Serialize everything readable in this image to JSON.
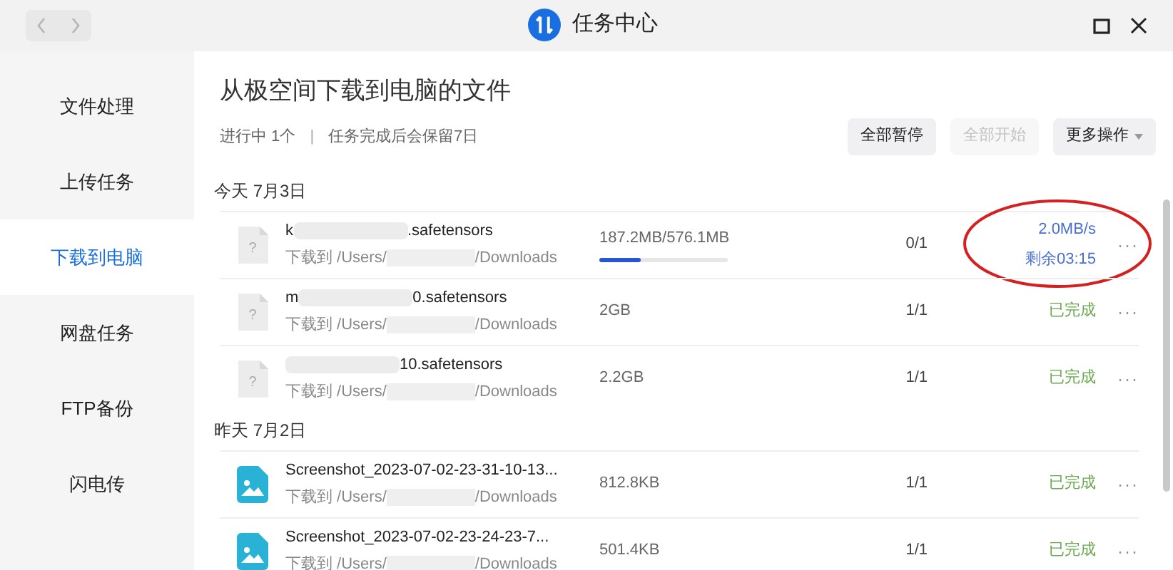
{
  "window": {
    "title": "任务中心"
  },
  "sidebar": {
    "items": [
      {
        "label": "文件处理",
        "selected": false
      },
      {
        "label": "上传任务",
        "selected": false
      },
      {
        "label": "下载到电脑",
        "selected": true
      },
      {
        "label": "网盘任务",
        "selected": false
      },
      {
        "label": "FTP备份",
        "selected": false
      },
      {
        "label": "闪电传",
        "selected": false
      }
    ]
  },
  "header": {
    "title": "从极空间下载到电脑的文件",
    "running": "进行中 1个",
    "separator": "|",
    "retention": "任务完成后会保留7日",
    "buttons": [
      {
        "label": "全部暂停",
        "disabled": false
      },
      {
        "label": "全部开始",
        "disabled": true
      },
      {
        "label": "更多操作",
        "disabled": false,
        "dropdown": true
      }
    ]
  },
  "groups": [
    {
      "date": "今天 7月3日",
      "tasks": [
        {
          "file_icon": {
            "kind": "unknown",
            "glyph": "?"
          },
          "name_start": "k",
          "name_end": ".safetensors",
          "redacted": true,
          "path_start": "下载到 /Users/",
          "path_end": "/Downloads",
          "size": "187.2MB/576.1MB",
          "level": 0.325,
          "count": "0/1",
          "kind": "downloading",
          "speed": "2.0MB/s",
          "remaining": "剩余03:15",
          "more": "···",
          "highlighted": true
        },
        {
          "file_icon": {
            "kind": "unknown",
            "glyph": "?"
          },
          "name_start": "m",
          "name_end": "0.safetensors",
          "redacted": true,
          "path_start": "下载到 /Users/",
          "path_end": "/Downloads",
          "size": "2GB",
          "count": "1/1",
          "kind": "done",
          "status": "已完成",
          "more": "···",
          "highlighted": false
        },
        {
          "file_icon": {
            "kind": "unknown",
            "glyph": "?"
          },
          "name_end": "10.safetensors",
          "redacted": true,
          "path_start": "下载到 /Users/",
          "path_end": "/Downloads",
          "size": "2.2GB",
          "count": "1/1",
          "kind": "done",
          "status": "已完成",
          "more": "···",
          "highlighted": false
        }
      ]
    },
    {
      "date": "昨天 7月2日",
      "tasks": [
        {
          "file_icon": {
            "kind": "image"
          },
          "name_start": "Screenshot_2023-07-02-23-31-10-13...",
          "redacted": false,
          "path_start": "下载到 /Users/",
          "path_end": "/Downloads",
          "size": "812.8KB",
          "count": "1/1",
          "kind": "done",
          "status": "已完成",
          "more": "···",
          "highlighted": false
        },
        {
          "file_icon": {
            "kind": "image"
          },
          "name_start": "Screenshot_2023-07-02-23-24-23-7...",
          "redacted": false,
          "path_start": "下载到 /Users/",
          "path_end": "/Downloads",
          "size": "501.4KB",
          "count": "1/1",
          "kind": "done",
          "status": "已完成",
          "more": "···",
          "highlighted": false
        }
      ]
    }
  ]
}
